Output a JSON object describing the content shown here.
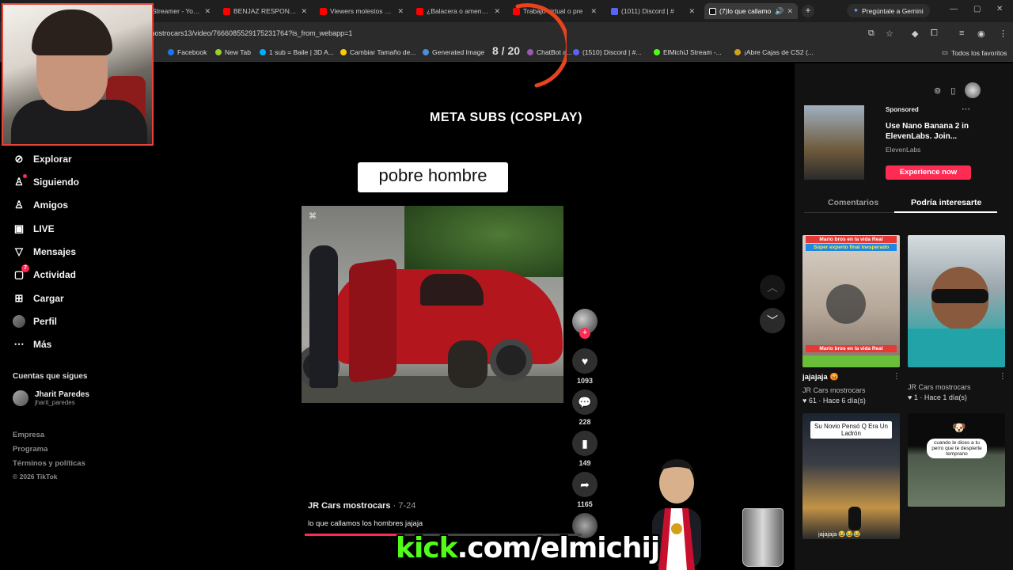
{
  "browser": {
    "tabs": [
      {
        "label": "Streamer - YouTube",
        "favicon_color": "#ff0000",
        "active": false
      },
      {
        "label": "BENJAZ RESPONDE",
        "favicon_color": "#ff0000",
        "active": false
      },
      {
        "label": "Viewers molestos con",
        "favicon_color": "#ff0000",
        "active": false
      },
      {
        "label": "¿Balacera o amenaza",
        "favicon_color": "#ff0000",
        "active": false
      },
      {
        "label": "Trabajo virtual o pre",
        "favicon_color": "#ff0000",
        "active": false
      },
      {
        "label": "(1011) Discord | #",
        "favicon_color": "#5865f2",
        "active": false
      },
      {
        "label": "(7)lo que callamo",
        "favicon_color": "#ffffff",
        "active": true
      }
    ],
    "gemini_button": "Pregúntale a Gemini",
    "url": "mostrocars13/video/7666085529175231764?is_from_webapp=1",
    "bookmarks": [
      {
        "label": "Facebook",
        "color": "#1877f2"
      },
      {
        "label": "New Tab",
        "color": "#9acd32"
      },
      {
        "label": "1 sub = Baile | 3D A...",
        "color": "#00b0ff"
      },
      {
        "label": "Cambiar Tamaño de...",
        "color": "#ffcc00"
      },
      {
        "label": "Generated Image",
        "color": "#4a90d9"
      },
      {
        "label": "ChatBot a...",
        "color": "#9b59b6"
      },
      {
        "label": "(1510) Discord | #...",
        "color": "#5865f2"
      },
      {
        "label": "ElMichiJ Stream -...",
        "color": "#53fc18"
      },
      {
        "label": "¡Abre Cajas de CS2 (...",
        "color": "#d4a017"
      }
    ],
    "favorites_label": "Todos los favoritos"
  },
  "sidebar": {
    "items": [
      {
        "label": "Explorar",
        "icon": "compass-icon",
        "glyph": "⊘"
      },
      {
        "label": "Siguiendo",
        "icon": "following-icon",
        "glyph": "👤"
      },
      {
        "label": "Amigos",
        "icon": "friends-icon",
        "glyph": "👥"
      },
      {
        "label": "LIVE",
        "icon": "live-icon",
        "glyph": "▣"
      },
      {
        "label": "Mensajes",
        "icon": "messages-icon",
        "glyph": "▽"
      },
      {
        "label": "Actividad",
        "icon": "activity-icon",
        "glyph": "▢",
        "badge": "7"
      },
      {
        "label": "Cargar",
        "icon": "upload-icon",
        "glyph": "⊞"
      },
      {
        "label": "Perfil",
        "icon": "profile-avatar"
      },
      {
        "label": "Más",
        "icon": "more-icon",
        "glyph": "⋯"
      }
    ],
    "following_title": "Cuentas que sigues",
    "following": [
      {
        "name": "Jharit Paredes",
        "handle": "jharit_paredes"
      }
    ],
    "footer": [
      "Empresa",
      "Programa",
      "Términos y políticas",
      "© 2026 TikTok"
    ]
  },
  "video": {
    "overlay_title": "META SUBS (COSPLAY)",
    "caption": "pobre hombre",
    "counter": "8 / 20",
    "author": "JR Cars mostrocars",
    "date": "7-24",
    "description": "lo que callamos los hombres jajaja",
    "likes": "1093",
    "comments": "228",
    "saves": "149",
    "shares": "1165",
    "progress": 0.35
  },
  "overlays": {
    "kick_prefix": "kick",
    "kick_suffix": ".com/elmichij"
  },
  "right_panel": {
    "ad": {
      "sponsored": "Sponsored",
      "title": "Use Nano Banana 2 in ElevenLabs. Join...",
      "brand": "ElevenLabs",
      "cta": "Experience now"
    },
    "tabs": [
      "Comentarios",
      "Podría interesarte"
    ],
    "recommendations": [
      {
        "caption": "jajajaja 😡",
        "author": "JR Cars mostrocars",
        "stats": "♥ 61 · Hace 6 día(s)",
        "banner_top": "Mario bros en la vida Real",
        "banner_sub": "Súper experto final inesperado",
        "banner_bottom": "Mario bros en la vida Real"
      },
      {
        "caption": "",
        "author": "JR Cars mostrocars",
        "stats": "♥ 1 · Hace 1 día(s)"
      },
      {
        "caption": "",
        "author": "",
        "stats": "",
        "meme": "Su Novio Pensó Q Era Un Ladrón",
        "tag": "jajajaja 😂😂😂"
      },
      {
        "caption": "",
        "author": "",
        "stats": "",
        "meme": "cuando le dices a tu perro que te despierte temprano"
      }
    ]
  }
}
